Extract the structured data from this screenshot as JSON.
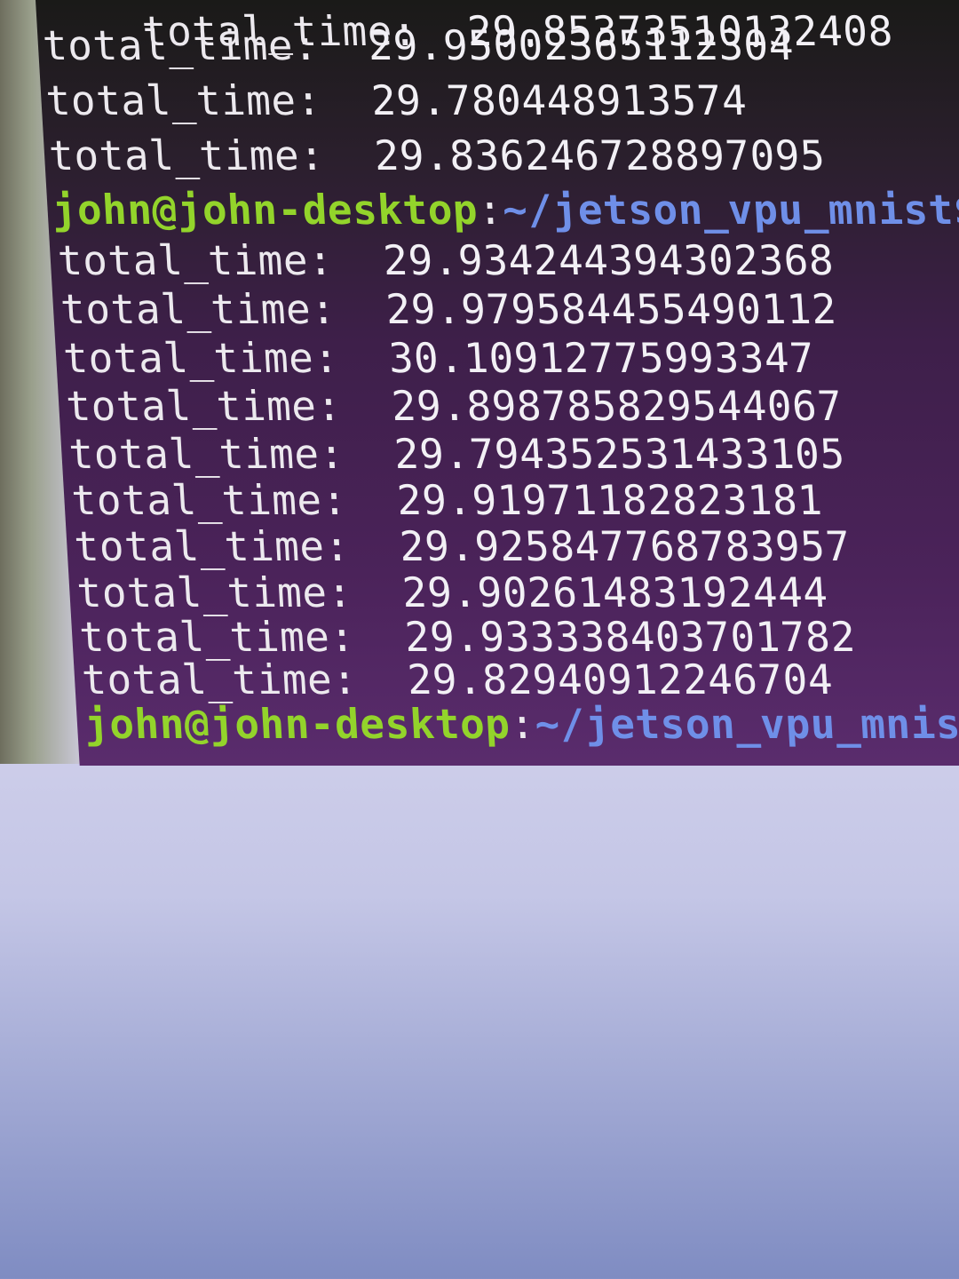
{
  "terminal": {
    "partial_line": {
      "label": "total_time:",
      "value": "29.85373510132408"
    },
    "block_a": [
      {
        "label": "total_time:",
        "value": "29.95002365112304"
      },
      {
        "label": "total_time:",
        "value": "29.780448913574"
      },
      {
        "label": "total_time:",
        "value": "29.836246728897095"
      }
    ],
    "prompt1": {
      "user_host": "john@john-desktop",
      "colon": ":",
      "path": "~/jetson_vpu_mnist$"
    },
    "block_b": [
      {
        "label": "total_time:",
        "value": "29.934244394302368"
      },
      {
        "label": "total_time:",
        "value": "29.979584455490112"
      },
      {
        "label": "total_time:",
        "value": "30.10912775993347"
      },
      {
        "label": "total_time:",
        "value": "29.898785829544067"
      },
      {
        "label": "total_time:",
        "value": "29.794352531433105"
      },
      {
        "label": "total_time:",
        "value": "29.91971182823181"
      },
      {
        "label": "total_time:",
        "value": "29.925847768783957"
      },
      {
        "label": "total_time:",
        "value": "29.90261483192444"
      },
      {
        "label": "total_time:",
        "value": "29.933338403701782"
      },
      {
        "label": "total_time:",
        "value": "29.82940912246704"
      }
    ],
    "prompt2": {
      "user_host": "john@john-desktop",
      "colon": ":",
      "path": "~/jetson_vpu_mnist$"
    }
  }
}
